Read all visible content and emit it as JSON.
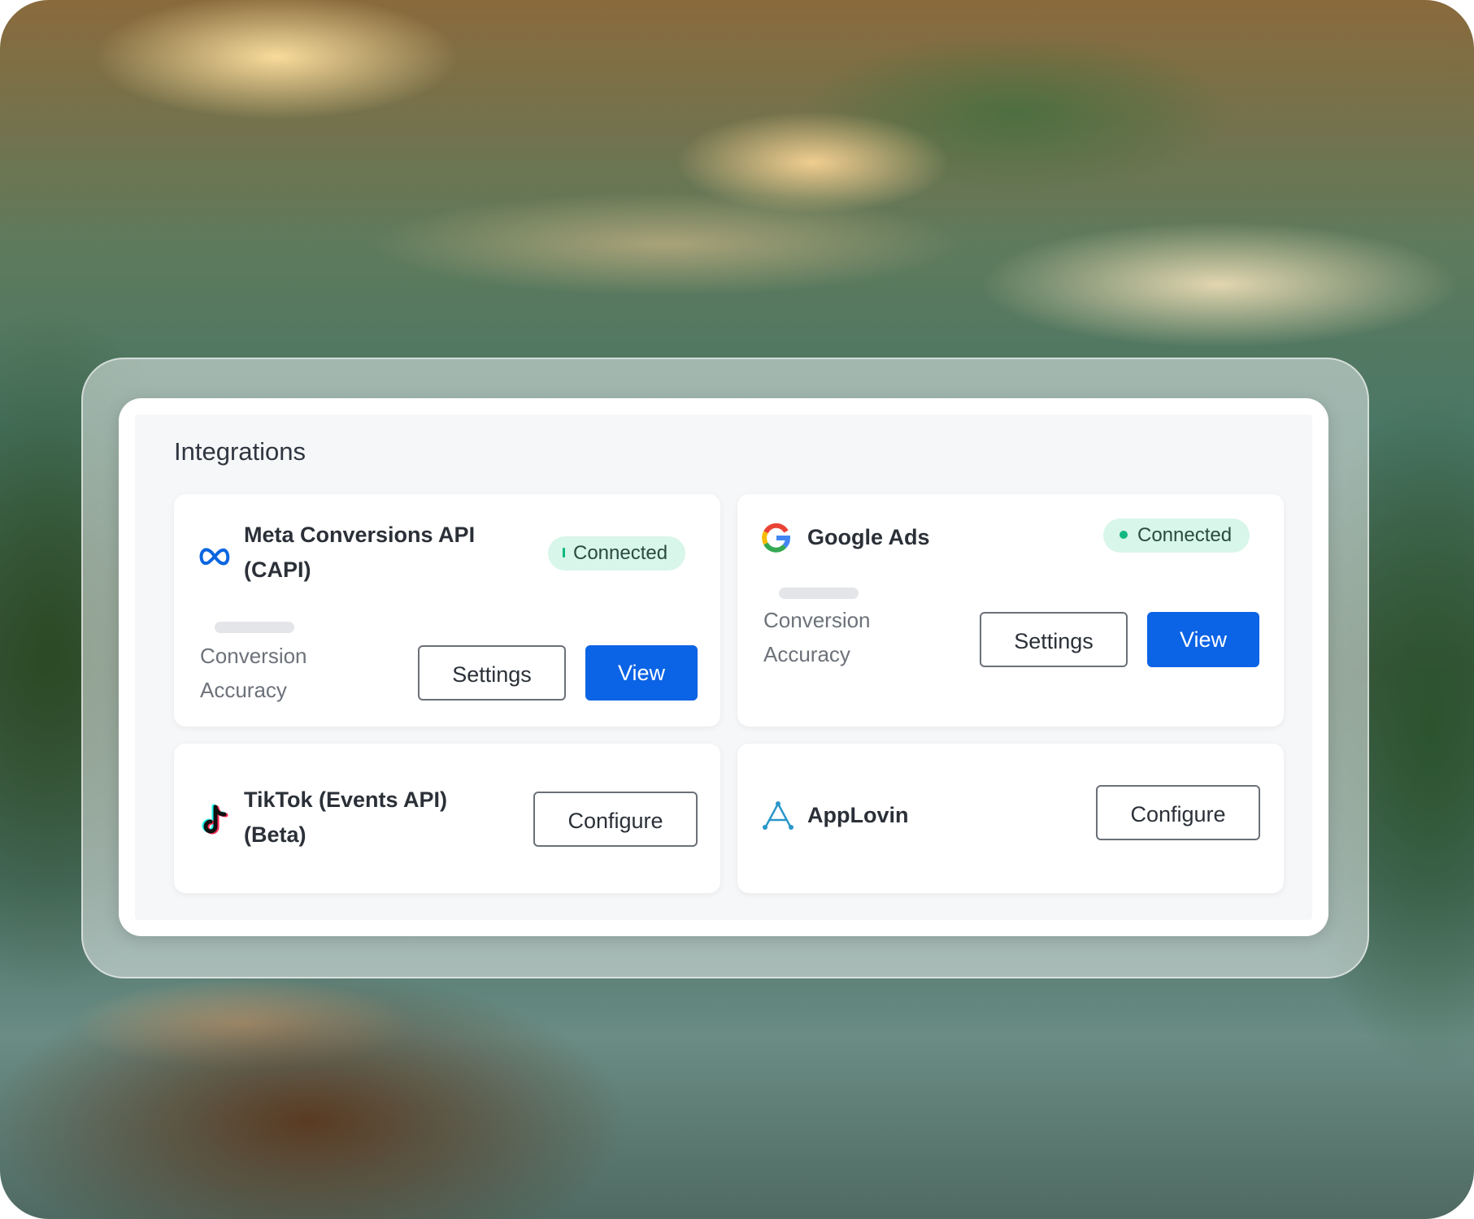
{
  "panel": {
    "title": "Integrations"
  },
  "integrations": [
    {
      "name_line1": "Meta Conversions API",
      "name_line2": "(CAPI)",
      "icon": "meta-infinity-icon",
      "status": "Connected",
      "metric_line1": "Conversion",
      "metric_line2": "Accuracy",
      "settings_label": "Settings",
      "view_label": "View"
    },
    {
      "name_line1": "Google Ads",
      "icon": "google-g-icon",
      "status": "Connected",
      "metric_line1": "Conversion",
      "metric_line2": "Accuracy",
      "settings_label": "Settings",
      "view_label": "View"
    },
    {
      "name_line1": "TikTok (Events API)",
      "name_line2": "(Beta)",
      "icon": "tiktok-note-icon",
      "configure_label": "Configure"
    },
    {
      "name_line1": "AppLovin",
      "icon": "applovin-a-icon",
      "configure_label": "Configure"
    }
  ],
  "colors": {
    "primary_button": "#0b63e5",
    "badge_background": "#d8f6ea",
    "badge_dot": "#10b981"
  }
}
